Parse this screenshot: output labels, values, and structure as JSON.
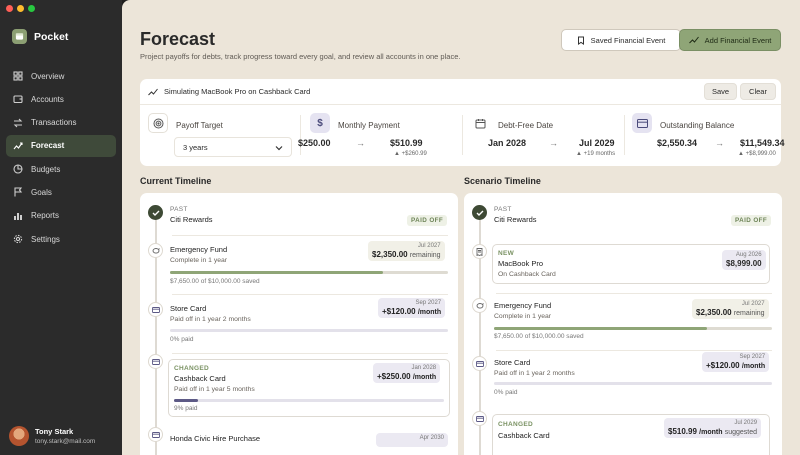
{
  "app": {
    "name": "Pocket"
  },
  "colors": {
    "accent": "#8fa577",
    "sidebar": "#2b2b2b",
    "background": "#ece5d9",
    "purple": "#5d5a86"
  },
  "sidebar": {
    "items": [
      {
        "label": "Overview",
        "icon": "grid-icon"
      },
      {
        "label": "Accounts",
        "icon": "wallet-icon"
      },
      {
        "label": "Transactions",
        "icon": "arrows-swap-icon"
      },
      {
        "label": "Forecast",
        "icon": "trend-line-icon",
        "active": true
      },
      {
        "label": "Budgets",
        "icon": "pie-chart-icon"
      },
      {
        "label": "Goals",
        "icon": "flag-icon"
      },
      {
        "label": "Reports",
        "icon": "bar-chart-icon"
      },
      {
        "label": "Settings",
        "icon": "gear-icon"
      }
    ],
    "user": {
      "name": "Tony Stark",
      "email": "tony.stark@mail.com"
    }
  },
  "header": {
    "title": "Forecast",
    "subtitle": "Project payoffs for debts, track progress toward every goal, and review all accounts in one place.",
    "saved_label": "Saved Financial Event",
    "add_label": "Add Financial Event"
  },
  "simulation": {
    "label": "Simulating MacBook Pro on Cashback Card",
    "save": "Save",
    "clear": "Clear",
    "payoff": {
      "label": "Payoff Target",
      "value": "3 years"
    },
    "monthly": {
      "label": "Monthly Payment",
      "from": "$250.00",
      "to": "$510.99",
      "delta": "+$260.99"
    },
    "debtfree": {
      "label": "Debt-Free Date",
      "from": "Jan 2028",
      "to": "Jul 2029",
      "delta": "+19 months"
    },
    "balance": {
      "label": "Outstanding Balance",
      "from": "$2,550.34",
      "to": "$11,549.34",
      "delta": "+$8,999.00"
    }
  },
  "current": {
    "title": "Current Timeline",
    "past": {
      "tag": "PAST",
      "name": "Citi Rewards",
      "badge": "PAID OFF"
    },
    "emergency": {
      "name": "Emergency Fund",
      "sub": "Complete in 1 year",
      "date": "Jul 2027",
      "amount": "$2,350.00",
      "unit": "remaining",
      "note": "$7,650.00 of $10,000.00 saved",
      "progress": 0.765
    },
    "store": {
      "name": "Store Card",
      "sub": "Paid off in 1 year 2 months",
      "date": "Sep 2027",
      "amount": "+$120.00",
      "unit": "/month",
      "note": "0% paid",
      "progress": 0
    },
    "cashback": {
      "tag": "CHANGED",
      "name": "Cashback Card",
      "sub": "Paid off in 1 year 5 months",
      "date": "Jan 2028",
      "amount": "+$250.00",
      "unit": "/month",
      "note": "9% paid",
      "progress": 0.09
    },
    "honda": {
      "name": "Honda Civic Hire Purchase",
      "date": "Apr 2030"
    }
  },
  "scenario": {
    "title": "Scenario Timeline",
    "past": {
      "tag": "PAST",
      "name": "Citi Rewards",
      "badge": "PAID OFF"
    },
    "macbook": {
      "tag": "NEW",
      "name": "MacBook Pro",
      "sub": "On Cashback Card",
      "date": "Aug 2026",
      "amount": "$8,999.00"
    },
    "emergency": {
      "name": "Emergency Fund",
      "sub": "Complete in 1 year",
      "date": "Jul 2027",
      "amount": "$2,350.00",
      "unit": "remaining",
      "note": "$7,650.00 of $10,000.00 saved",
      "progress": 0.765
    },
    "store": {
      "name": "Store Card",
      "sub": "Paid off in 1 year 2 months",
      "date": "Sep 2027",
      "amount": "+$120.00",
      "unit": "/month",
      "note": "0% paid"
    },
    "cashback": {
      "tag": "CHANGED",
      "name": "Cashback Card",
      "date": "Jul 2029",
      "amount": "$510.99",
      "unit": "/month",
      "suffix": "suggested"
    }
  }
}
